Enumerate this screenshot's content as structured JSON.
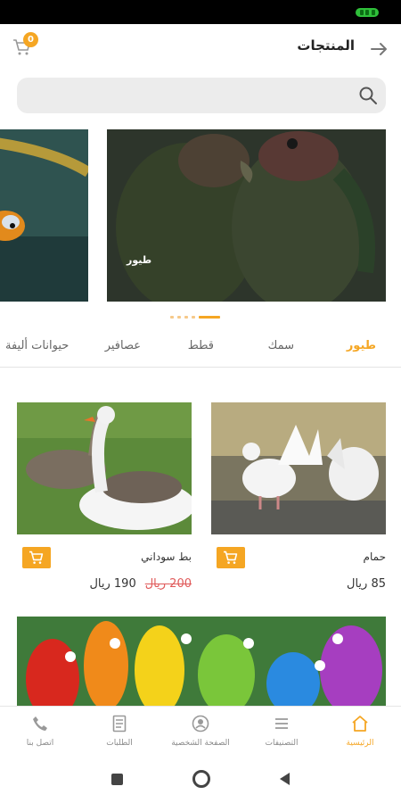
{
  "header": {
    "title": "المنتجات",
    "cart_count": "0"
  },
  "carousel": {
    "main_caption": "طيور",
    "dots_total": 5,
    "active_dot": 4
  },
  "categories": [
    "طيور",
    "سمك",
    "قطط",
    "عصافير",
    "حيوانات أليفة"
  ],
  "active_category": "طيور",
  "products": [
    {
      "name": "حمام",
      "price": "85 ريال",
      "old_price": ""
    },
    {
      "name": "بط سوداني",
      "price": "190 ريال",
      "old_price": "200 ريال"
    }
  ],
  "bottom_nav": [
    {
      "label": "الرئيسية",
      "icon": "home-icon"
    },
    {
      "label": "التصنيفات",
      "icon": "list-icon"
    },
    {
      "label": "الصفحة الشخصية",
      "icon": "user-icon"
    },
    {
      "label": "الطلبات",
      "icon": "orders-icon"
    },
    {
      "label": "اتصل بنا",
      "icon": "phone-icon"
    }
  ],
  "colors": {
    "accent": "#f5a623",
    "search_bg": "#ececec"
  }
}
